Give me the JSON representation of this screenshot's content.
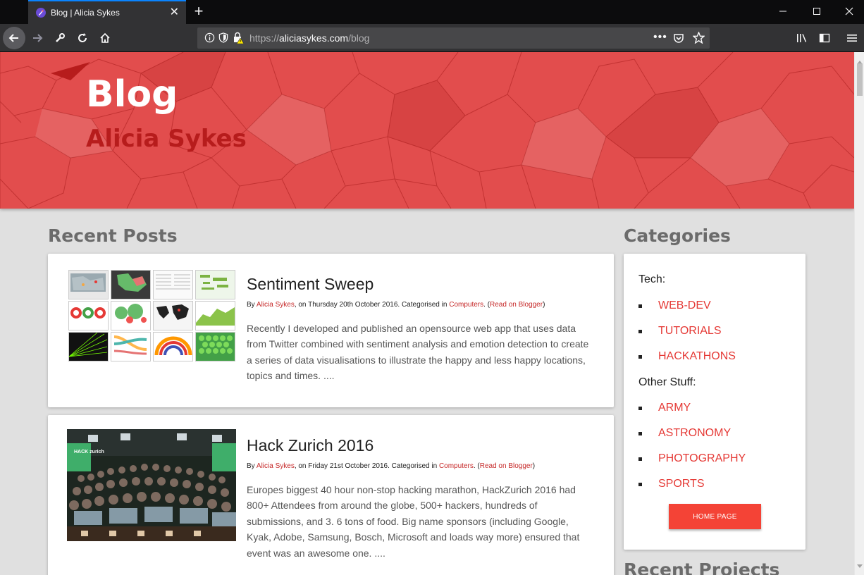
{
  "browser": {
    "tab_title": "Blog | Alicia Sykes",
    "url_scheme": "https://",
    "url_host": "aliciasykes.com",
    "url_path": "/blog"
  },
  "hero": {
    "title": "Blog",
    "subtitle": "Alicia Sykes",
    "color": "#e24d4d"
  },
  "recent_posts": {
    "heading": "Recent Posts",
    "posts": [
      {
        "title": "Sentiment Sweep",
        "by": "By ",
        "author": "Alicia Sykes",
        "date_text": ", on Thursday 20th October 2016. Categorised in ",
        "category": "Computers",
        "sep": ". (",
        "blogger_link": "Read on Blogger",
        "close": ")",
        "body": "Recently I developed and published an opensource web app that uses data from Twitter combined with sentiment analysis and emotion detection to create a series of data visualisations to illustrate the happy and less happy locations, topics and times. ....",
        "thumbs": [
          "Heat Map",
          "Regional Map",
          "Raw Tweets",
          "Word Cloud",
          "Comparison",
          "Trending Now",
          "The World Now",
          "Time Line",
          "3D Globe",
          "Entity Extraction",
          "Tone Analyzer",
          "Sentiment Search"
        ]
      },
      {
        "title": "Hack Zurich 2016",
        "by": "By ",
        "author": "Alicia Sykes",
        "date_text": ", on Friday 21st October 2016. Categorised in ",
        "category": "Computers",
        "sep": ". (",
        "blogger_link": "Read on Blogger",
        "close": ")",
        "body": "Europes biggest 40 hour non-stop hacking marathon, HackZurich 2016 had  800+ Attendees from around the globe, 500+ hackers, hundreds of submissions, and 3. 6 tons of food. Big name sponsors (including Google, Kyak, Adobe, Samsung, Bosch, Microsoft and loads way more) ensured that event was an awesome one. ....",
        "photo_banner": "HACK zurich"
      }
    ]
  },
  "categories": {
    "heading": "Categories",
    "tech_label": "Tech:",
    "tech": [
      "WEB-DEV",
      "TUTORIALS",
      "HACKATHONS"
    ],
    "other_label": "Other Stuff:",
    "other": [
      "ARMY",
      "ASTRONOMY",
      "PHOTOGRAPHY",
      "SPORTS"
    ],
    "home_button": "HOME PAGE",
    "accent": "#e53935"
  },
  "recent_projects": {
    "heading": "Recent Projects"
  }
}
